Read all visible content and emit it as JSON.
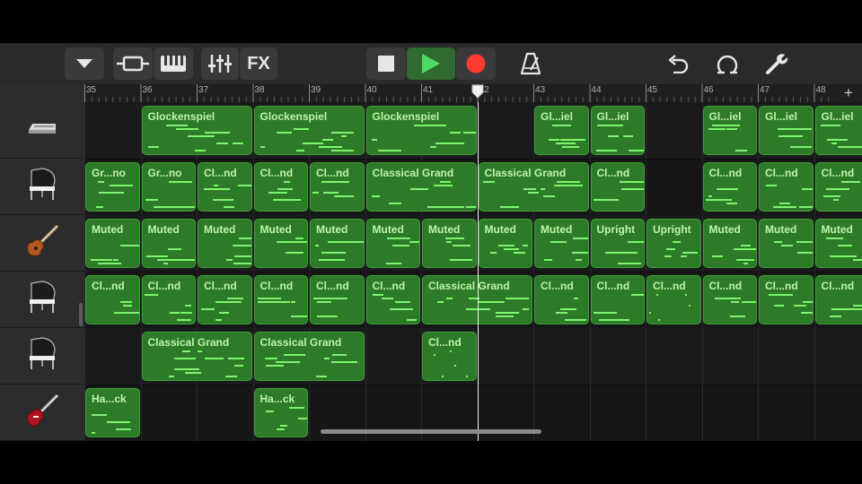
{
  "toolbar": {
    "fx_label": "FX"
  },
  "ruler": {
    "bars": [
      "35",
      "36",
      "37",
      "38",
      "39",
      "40",
      "41",
      "42",
      "43",
      "44",
      "45",
      "46",
      "47",
      "48"
    ],
    "add_symbol": "+"
  },
  "tracks": [
    {
      "instrument_icon": "keyboard-icon",
      "regions": [
        {
          "label": "Glockenspiel",
          "start": 36,
          "len": 2
        },
        {
          "label": "Glockenspiel",
          "start": 38,
          "len": 2
        },
        {
          "label": "Glockenspiel",
          "start": 40,
          "len": 2
        },
        {
          "label": "Gl...iel",
          "start": 43,
          "len": 1
        },
        {
          "label": "Gl...iel",
          "start": 44,
          "len": 1
        },
        {
          "label": "Gl...iel",
          "start": 46,
          "len": 1
        },
        {
          "label": "Gl...iel",
          "start": 47,
          "len": 1
        },
        {
          "label": "Gl...iel",
          "start": 48,
          "len": 1
        }
      ]
    },
    {
      "instrument_icon": "grand-piano-icon",
      "regions": [
        {
          "label": "Gr...no",
          "start": 35,
          "len": 1
        },
        {
          "label": "Gr...no",
          "start": 36,
          "len": 1
        },
        {
          "label": "Cl...nd",
          "start": 37,
          "len": 1
        },
        {
          "label": "Cl...nd",
          "start": 38,
          "len": 1
        },
        {
          "label": "Cl...nd",
          "start": 39,
          "len": 1
        },
        {
          "label": "Classical Grand",
          "start": 40,
          "len": 2
        },
        {
          "label": "Classical Grand",
          "start": 42,
          "len": 2
        },
        {
          "label": "Cl...nd",
          "start": 44,
          "len": 1
        },
        {
          "label": "Cl...nd",
          "start": 46,
          "len": 1
        },
        {
          "label": "Cl...nd",
          "start": 47,
          "len": 1
        },
        {
          "label": "Cl...nd",
          "start": 48,
          "len": 1
        }
      ]
    },
    {
      "instrument_icon": "bass-guitar-icon",
      "regions": [
        {
          "label": "Muted",
          "start": 35,
          "len": 1
        },
        {
          "label": "Muted",
          "start": 36,
          "len": 1
        },
        {
          "label": "Muted",
          "start": 37,
          "len": 1
        },
        {
          "label": "Muted",
          "start": 38,
          "len": 1
        },
        {
          "label": "Muted",
          "start": 39,
          "len": 1
        },
        {
          "label": "Muted",
          "start": 40,
          "len": 1
        },
        {
          "label": "Muted",
          "start": 41,
          "len": 1
        },
        {
          "label": "Muted",
          "start": 42,
          "len": 1
        },
        {
          "label": "Muted",
          "start": 43,
          "len": 1
        },
        {
          "label": "Upright",
          "start": 44,
          "len": 1
        },
        {
          "label": "Upright",
          "start": 45,
          "len": 1
        },
        {
          "label": "Muted",
          "start": 46,
          "len": 1
        },
        {
          "label": "Muted",
          "start": 47,
          "len": 1
        },
        {
          "label": "Muted",
          "start": 48,
          "len": 1
        }
      ]
    },
    {
      "instrument_icon": "grand-piano-icon",
      "regions": [
        {
          "label": "Cl...nd",
          "start": 35,
          "len": 1
        },
        {
          "label": "Cl...nd",
          "start": 36,
          "len": 1
        },
        {
          "label": "Cl...nd",
          "start": 37,
          "len": 1
        },
        {
          "label": "Cl...nd",
          "start": 38,
          "len": 1
        },
        {
          "label": "Cl...nd",
          "start": 39,
          "len": 1
        },
        {
          "label": "Cl...nd",
          "start": 40,
          "len": 1
        },
        {
          "label": "Classical Grand",
          "start": 41,
          "len": 2
        },
        {
          "label": "Cl...nd",
          "start": 43,
          "len": 1
        },
        {
          "label": "Cl...nd",
          "start": 44,
          "len": 1
        },
        {
          "label": "Cl...nd",
          "start": 45,
          "len": 1
        },
        {
          "label": "Cl...nd",
          "start": 46,
          "len": 1
        },
        {
          "label": "Cl...nd",
          "start": 47,
          "len": 1
        },
        {
          "label": "Cl...nd",
          "start": 48,
          "len": 1
        }
      ]
    },
    {
      "instrument_icon": "grand-piano-icon",
      "regions": [
        {
          "label": "Classical Grand",
          "start": 36,
          "len": 2
        },
        {
          "label": "Classical Grand",
          "start": 38,
          "len": 2
        },
        {
          "label": "Cl...nd",
          "start": 41,
          "len": 1
        }
      ]
    },
    {
      "instrument_icon": "electric-guitar-icon",
      "regions": [
        {
          "label": "Ha...ck",
          "start": 35,
          "len": 1
        },
        {
          "label": "Ha...ck",
          "start": 38,
          "len": 1
        }
      ]
    }
  ],
  "playhead_bar": 42.0,
  "colors": {
    "region_fill": "#2d7a28",
    "region_border": "#3fa038",
    "note": "#7ef56e",
    "play": "#4cd964",
    "record": "#ff3b30"
  }
}
